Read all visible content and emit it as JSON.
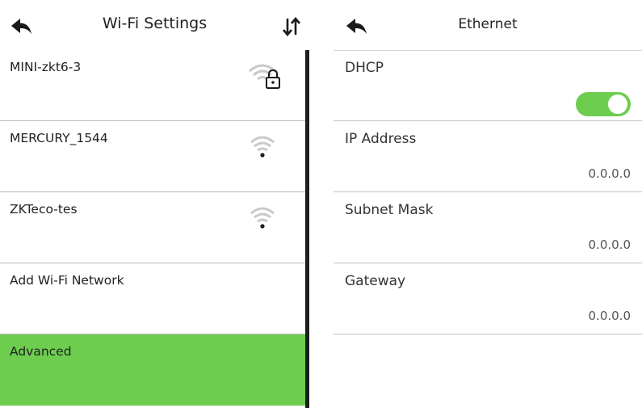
{
  "wifi_settings": {
    "title": "Wi-Fi Settings",
    "back_icon": "back-arrow-icon",
    "sort_icon": "sort-arrows-icon",
    "networks": [
      {
        "name": "MINI-zkt6-3",
        "icon": "wifi-locked-icon"
      },
      {
        "name": "MERCURY_1544",
        "icon": "wifi-icon"
      },
      {
        "name": "ZKTeco-tes",
        "icon": "wifi-icon"
      }
    ],
    "add_network_label": "Add Wi-Fi Network",
    "advanced_label": "Advanced"
  },
  "ethernet": {
    "title": "Ethernet",
    "back_icon": "back-arrow-icon",
    "dhcp": {
      "label": "DHCP",
      "enabled": true
    },
    "fields": [
      {
        "label": "IP Address",
        "value": "0.0.0.0"
      },
      {
        "label": "Subnet Mask",
        "value": "0.0.0.0"
      },
      {
        "label": "Gateway",
        "value": "0.0.0.0"
      }
    ]
  },
  "colors": {
    "accent_green": "#6dcd4f",
    "divider": "#b9b9b9",
    "scrollbar": "#1e1e1e"
  }
}
